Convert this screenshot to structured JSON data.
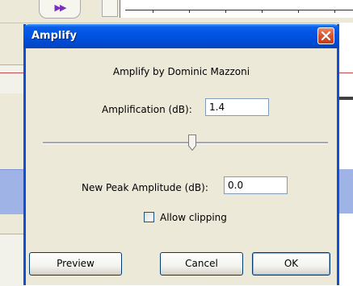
{
  "dialog": {
    "title": "Amplify",
    "header": "Amplify by Dominic Mazzoni",
    "amplification_label": "Amplification (dB):",
    "amplification_value": "1.4",
    "slider_level": 0.5,
    "peak_label": "New Peak Amplitude (dB):",
    "peak_value": "0.0",
    "allow_clipping_label": "Allow clipping",
    "allow_clipping_checked": false,
    "buttons": {
      "preview": "Preview",
      "cancel": "Cancel",
      "ok": "OK"
    }
  },
  "colors": {
    "titlebar_blue": "#0054e3",
    "dialog_bg": "#ece9d8",
    "close_red": "#d8542e"
  }
}
